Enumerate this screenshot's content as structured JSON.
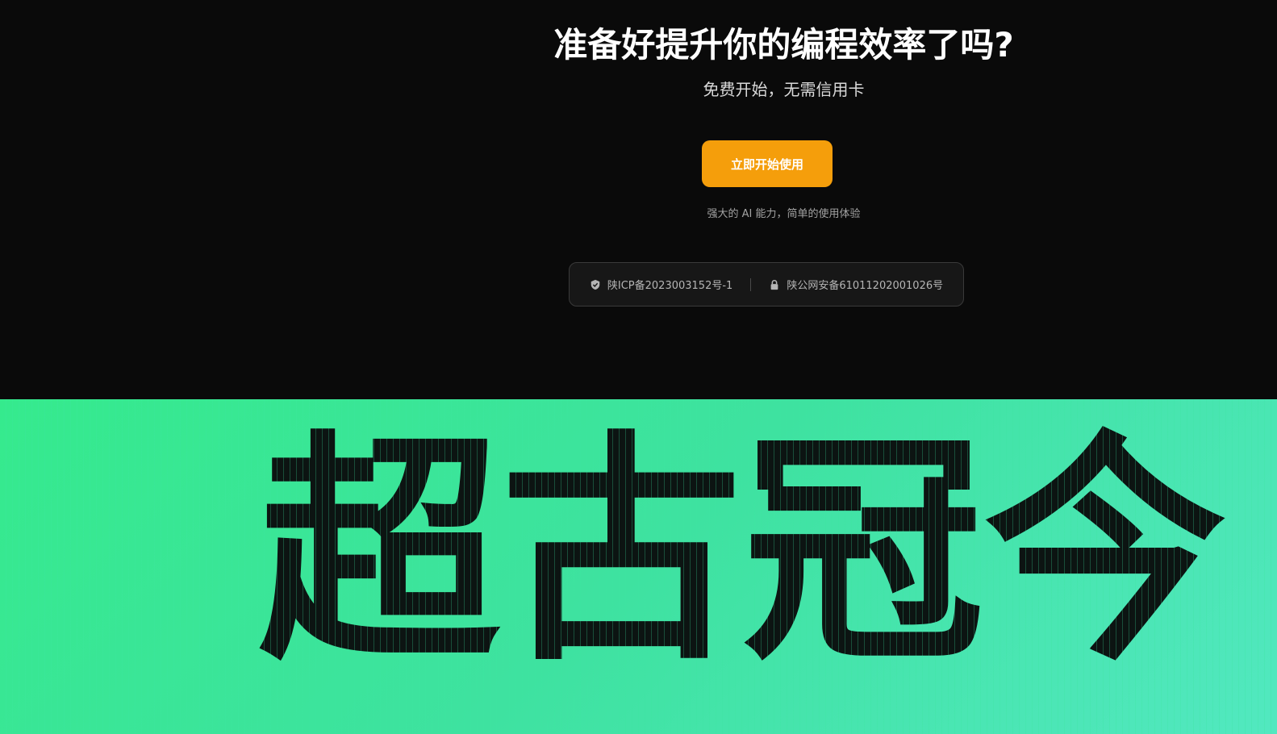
{
  "hero": {
    "title": "准备好提升你的编程效率了吗?",
    "subtitle": "免费开始，无需信用卡",
    "cta_label": "立即开始使用",
    "tagline": "强大的 AI 能力，简单的使用体验"
  },
  "filing": {
    "icp": "陕ICP备2023003152号-1",
    "police": "陕公网安备61011202001026号"
  },
  "brand": {
    "text": "超古冠今"
  },
  "colors": {
    "background": "#0a0a0a",
    "cta": "#f59e0b",
    "banner_start": "#35ea8d",
    "banner_end": "#52e8c0"
  },
  "icons": {
    "icp_icon": "shield-check-icon",
    "police_icon": "lock-icon"
  }
}
